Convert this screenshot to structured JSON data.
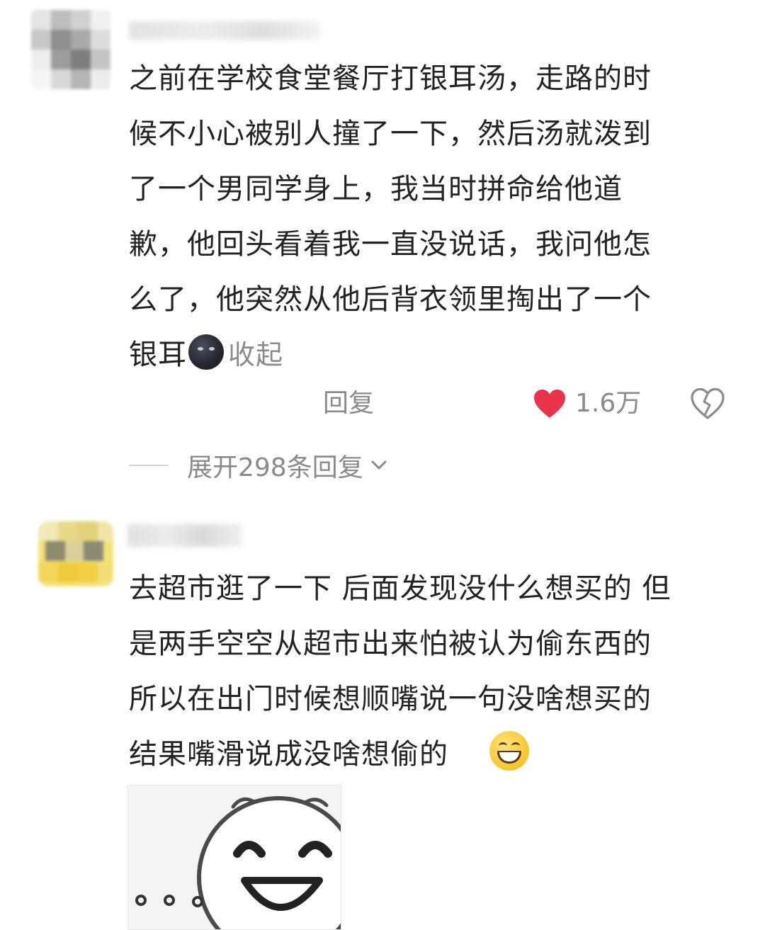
{
  "comments": [
    {
      "username": "",
      "text_lines": [
        "之前在学校食堂餐厅打银耳汤，走路的时",
        "候不小心被别人撞了一下，然后汤就泼到",
        "了一个男同学身上，我当时拼命给他道",
        "歉，他回头看着我一直没说话，我问他怎",
        "么了，他突然从他后背衣领里掏出了一个"
      ],
      "last_line": "银耳",
      "emoji": "new-moon-face-emoji",
      "collapse_label": "收起",
      "reply_label": "回复",
      "like_count": "1.6万",
      "liked": true,
      "expand_replies_label": "展开298条回复"
    },
    {
      "username": "",
      "text_lines": [
        "去超市逛了一下 后面发现没什么想买的 但",
        "是两手空空从超市出来怕被认为偷东西的",
        "所以在出门时候想顺嘴说一句没啥想买的"
      ],
      "last_line": "结果嘴滑说成没啥想偷的",
      "emoji": "grinning-sweat-emoji",
      "sticker": "smiling-face-sticker-image"
    }
  ],
  "colors": {
    "like_heart": "#e8334a",
    "muted_text": "#8a8a8a",
    "body_text": "#222222"
  },
  "icons": {
    "like": "heart-icon",
    "dislike": "broken-heart-icon",
    "expand": "chevron-down-icon"
  }
}
